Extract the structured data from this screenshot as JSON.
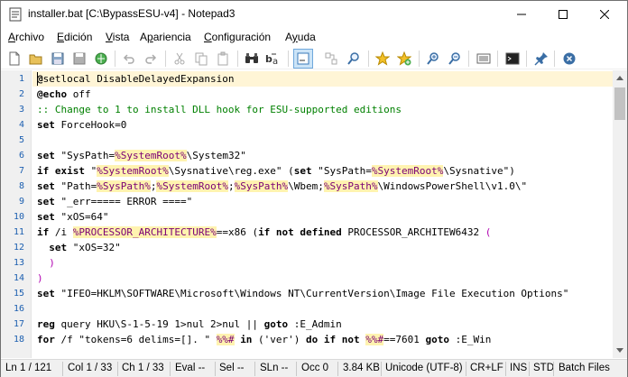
{
  "window": {
    "title": "installer.bat [C:\\BypassESU-v4] - Notepad3"
  },
  "menu": {
    "items": [
      {
        "label": "Archivo",
        "accel": "A",
        "rest": "rchivo"
      },
      {
        "label": "Edición",
        "accel": "E",
        "rest": "dición"
      },
      {
        "label": "Vista",
        "accel": "V",
        "rest": "ista"
      },
      {
        "label": "Apariencia",
        "accel": "p",
        "pre": "A",
        "rest": "ariencia"
      },
      {
        "label": "Configuración",
        "accel": "C",
        "rest": "onfiguración"
      },
      {
        "label": "Ayuda",
        "accel": "y",
        "pre": "A",
        "rest": "uda"
      }
    ]
  },
  "toolbar": {
    "buttons": [
      "new-file",
      "open-file",
      "save-file",
      "save-as",
      "browse",
      "undo",
      "redo",
      "cut",
      "copy",
      "paste",
      "find",
      "replace",
      "word-wrap",
      "show-whitespace",
      "zoom-find",
      "bookmark",
      "bookmark-add",
      "zoom-in",
      "zoom-out",
      "scheme",
      "console",
      "pin",
      "close"
    ]
  },
  "editor": {
    "line_numbers": [
      "1",
      "2",
      "3",
      "4",
      "5",
      "6",
      "7",
      "8",
      "9",
      "10",
      "11",
      "12",
      "13",
      "14",
      "15",
      "16",
      "17",
      "18"
    ]
  },
  "statusbar": {
    "ln": "Ln 1 / 121",
    "col": "Col 1 / 33",
    "ch": "Ch 1 / 33",
    "eval": "Eval --",
    "sel": "Sel --",
    "sln": "SLn --",
    "occ": "Occ 0",
    "size": "3.84 KB",
    "encoding": "Unicode (UTF-8)",
    "eol": "CR+LF",
    "ins": "INS",
    "std": "STD",
    "lexer": "Batch Files"
  },
  "colors": {
    "variable_highlight": "#fff3b0",
    "comment": "#008000",
    "line_number": "#1c5fb0"
  }
}
